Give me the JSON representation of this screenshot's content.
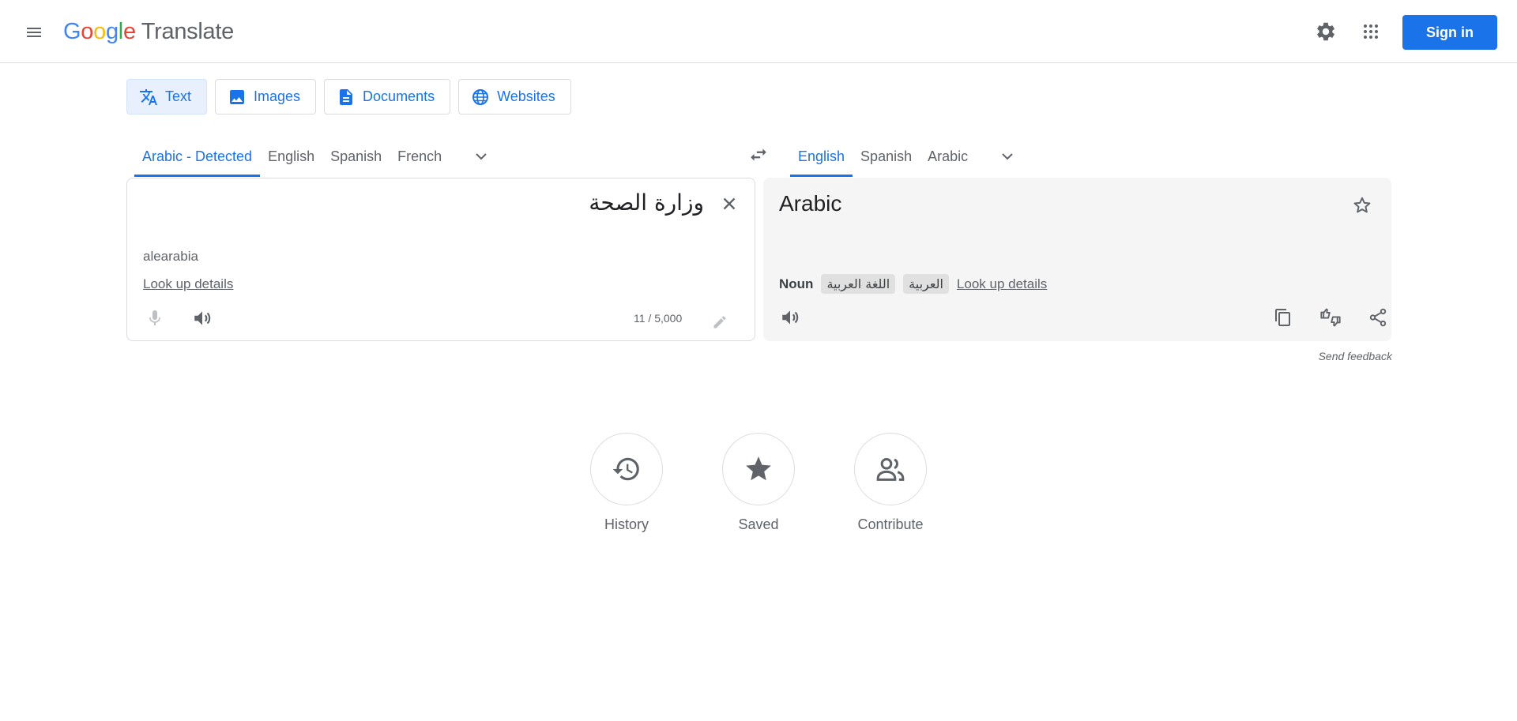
{
  "header": {
    "logo": {
      "letters": [
        "G",
        "o",
        "o",
        "g",
        "l",
        "e"
      ],
      "product": "Translate"
    },
    "sign_in_label": "Sign in"
  },
  "modes": [
    {
      "label": "Text",
      "icon": "translate-icon",
      "active": true
    },
    {
      "label": "Images",
      "icon": "image-icon",
      "active": false
    },
    {
      "label": "Documents",
      "icon": "document-icon",
      "active": false
    },
    {
      "label": "Websites",
      "icon": "globe-icon",
      "active": false
    }
  ],
  "source_langs": [
    "Arabic - Detected",
    "English",
    "Spanish",
    "French"
  ],
  "target_langs": [
    "English",
    "Spanish",
    "Arabic"
  ],
  "source": {
    "text": "وزارة الصحة",
    "transliteration": "alearabia",
    "lookup": "Look up details",
    "counter": "11 / 5,000"
  },
  "target": {
    "text": "Arabic",
    "pos": "Noun",
    "chips": [
      "اللغة العربية",
      "العربية"
    ],
    "lookup": "Look up details"
  },
  "feedback": "Send feedback",
  "bottom": [
    {
      "label": "History",
      "icon": "history-icon"
    },
    {
      "label": "Saved",
      "icon": "star-icon"
    },
    {
      "label": "Contribute",
      "icon": "people-icon"
    }
  ],
  "colors": {
    "accent": "#1a73e8",
    "active_bg": "#e8f0fe",
    "panel_bg": "#f5f5f5"
  }
}
